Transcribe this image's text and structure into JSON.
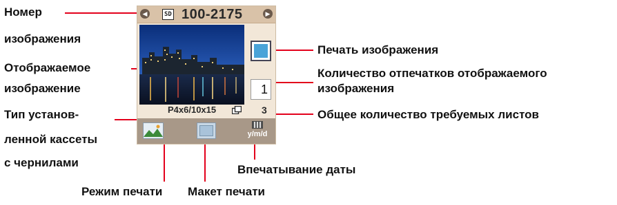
{
  "screen": {
    "file_number": "100-2175",
    "media_badge": "SD",
    "copies": "1",
    "cassette": "P4x6/10x15",
    "total_sheets": "3",
    "date_imprint": "y/m/d"
  },
  "callouts": {
    "image_number": [
      "Номер",
      "изображения"
    ],
    "displayed_image": [
      "Отображаемое",
      "изображение"
    ],
    "cassette_type": [
      "Тип установ-",
      "ленной кассеты",
      "с чернилами"
    ],
    "print_mode": "Режим печати",
    "print_layout": "Макет печати",
    "date_print": "Впечатывание даты",
    "print_image": "Печать изображения",
    "copies_count": [
      "Количество отпечатков отображаемого",
      "изображения"
    ],
    "total_sheets": "Общее количество требуемых листов"
  },
  "colors": {
    "leader_line": "#e3001b",
    "top_bar": "#d9c2a8",
    "bottom_bar": "#a89888",
    "print_indicator": "#4aa3d8"
  }
}
